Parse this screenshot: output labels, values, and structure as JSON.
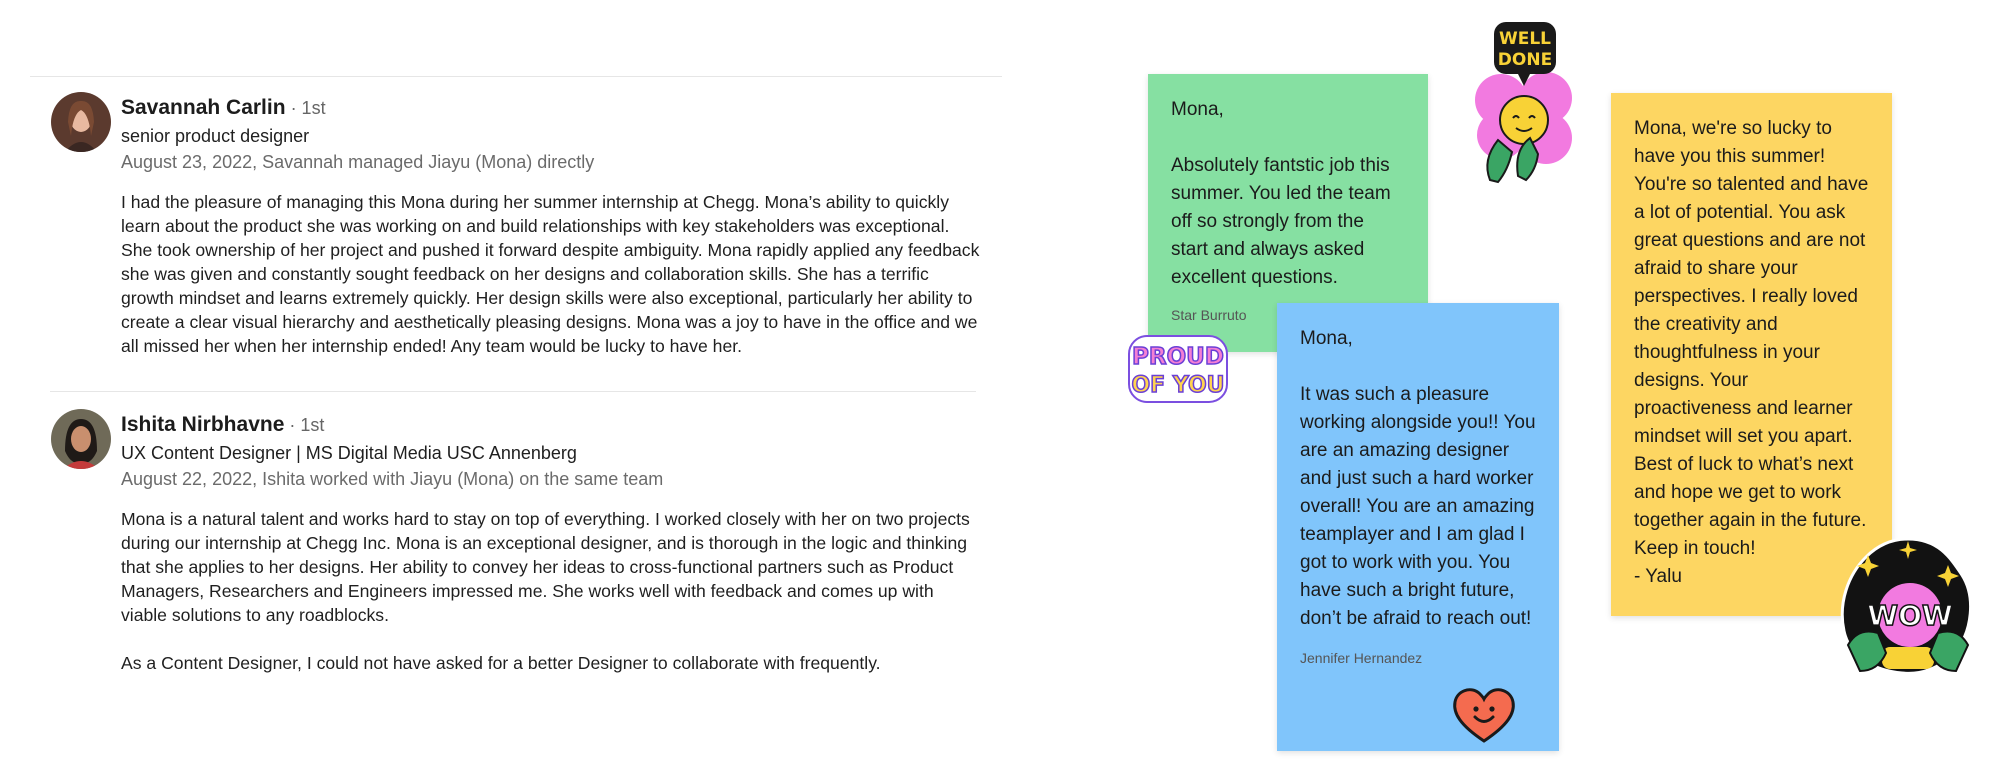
{
  "recommendations": [
    {
      "name": "Savannah Carlin",
      "degree": " · 1st",
      "headline": "senior product designer",
      "date": "August 23, 2022, Savannah managed Jiayu (Mona) directly",
      "paragraphs": [
        "I had the pleasure of managing this Mona during her summer internship at Chegg. Mona’s ability to quickly learn about the product she was working on and build relationships with key stakeholders was exceptional. She took ownership of her project and pushed it forward despite ambiguity. Mona rapidly applied any feedback she was given and constantly sought feedback on her designs and collaboration skills. She has a terrific growth mindset and learns extremely quickly. Her design skills were also exceptional, particularly her ability to create a clear visual hierarchy and aesthetically pleasing designs. Mona was a joy to have in the office and we all missed her when her internship ended! Any team would be lucky to have her."
      ]
    },
    {
      "name": "Ishita Nirbhavne",
      "degree": " · 1st",
      "headline": "UX Content Designer | MS Digital Media USC Annenberg",
      "date": "August 22, 2022, Ishita worked with Jiayu (Mona) on the same team",
      "paragraphs": [
        "Mona is a natural talent and works hard to stay on top of everything. I worked closely with her on two projects during our internship at Chegg Inc. Mona is an exceptional designer, and is thorough in the logic and thinking that she applies to her designs. Her ability to convey her ideas to cross-functional partners such as Product Managers, Researchers and Engineers impressed me. She works well with feedback and comes up with viable solutions to any roadblocks.",
        "As a Content Designer, I could not have asked for a better Designer to collaborate with frequently."
      ]
    }
  ],
  "notes": {
    "green": {
      "greeting": "Mona,",
      "text": "Absolutely fantstic job this summer. You led the team off so strongly from the start and always asked excellent questions.",
      "signature": "Star Burruto",
      "color": "#86e0a2"
    },
    "blue": {
      "greeting": "Mona,",
      "text": "It was such a pleasure working alongside you!! You are an amazing designer and just such a hard worker overall! You are an amazing teamplayer and I am glad I got to work with you. You have such a bright future, don’t be afraid to reach out!",
      "signature": "Jennifer Hernandez",
      "color": "#80c5fb"
    },
    "yellow": {
      "text": "Mona, we're so lucky to have you this summer! You're so talented and have a lot of potential. You ask great questions and are not afraid to share your perspectives. I really loved the creativity and thoughtfulness in your designs. Your proactiveness and learner mindset will set you apart. Best of luck to what’s next and hope we get to work together again in the future. Keep in touch!",
      "signature": "- Yalu",
      "color": "#fdd662"
    }
  },
  "stickers": {
    "well_done": [
      "WELL",
      "DONE"
    ],
    "proud": [
      "PROUD",
      "OF YOU"
    ],
    "wow": "WOW"
  }
}
